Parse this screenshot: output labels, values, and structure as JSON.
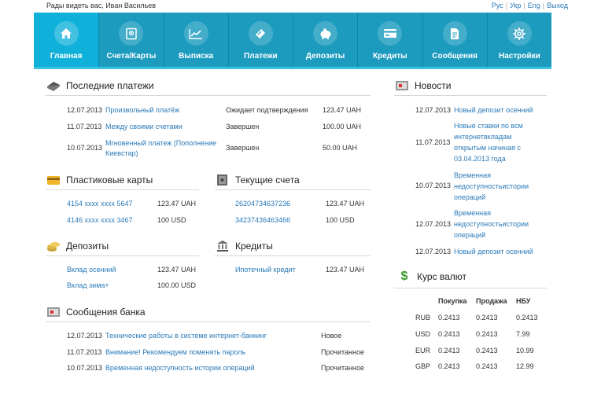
{
  "header": {
    "greeting": "Рады видеть вас, Иван Васильев",
    "langs": [
      "Рус",
      "Укр",
      "Eng"
    ],
    "logout": "Выход"
  },
  "nav": [
    {
      "label": "Главная",
      "icon": "home-icon"
    },
    {
      "label": "Счета/Карты",
      "icon": "accounts-icon"
    },
    {
      "label": "Выписка",
      "icon": "statement-chart-icon"
    },
    {
      "label": "Платежи",
      "icon": "wallet-icon"
    },
    {
      "label": "Депозиты",
      "icon": "piggy-bank-icon"
    },
    {
      "label": "Кредиты",
      "icon": "credit-card-icon"
    },
    {
      "label": "Сообщения",
      "icon": "document-icon"
    },
    {
      "label": "Настройки",
      "icon": "gear-icon"
    }
  ],
  "colors": {
    "nav": "#1c9bbf",
    "nav_active": "#0fb0d9",
    "link": "#2a7ab8"
  },
  "payments": {
    "title": "Последние платежи",
    "rows": [
      {
        "date": "12.07.2013",
        "name": "Произвольный платёж",
        "status": "Ожидает подтверждения",
        "amount": "123.47 UAH"
      },
      {
        "date": "11.07.2013",
        "name": "Между своими счетами",
        "status": "Завершен",
        "amount": "100.00 UAH"
      },
      {
        "date": "10.07.2013",
        "name": "Мгновенный платеж (Пополнение Киевстар)",
        "status": "Завершен",
        "amount": "50.00 UAH"
      }
    ]
  },
  "cards": {
    "title": "Пластиковые карты",
    "rows": [
      {
        "number": "4154 xxxx xxxx 5647",
        "amount": "123.47 UAH"
      },
      {
        "number": "4146 xxxx xxxx 3467",
        "amount": "100 USD"
      }
    ]
  },
  "accounts": {
    "title": "Текущие счета",
    "rows": [
      {
        "number": "26204734637236",
        "amount": "123.47 UAH"
      },
      {
        "number": "34237436463466",
        "amount": "100 USD"
      }
    ]
  },
  "deposits": {
    "title": "Депозиты",
    "rows": [
      {
        "name": "Вклад осенний",
        "amount": "123.47 UAH"
      },
      {
        "name": "Вклад зима+",
        "amount": "100.00 USD"
      }
    ]
  },
  "credits": {
    "title": "Кредиты",
    "rows": [
      {
        "name": "Ипотечный кредит",
        "amount": "123.47 UAH"
      }
    ]
  },
  "messages": {
    "title": "Сообщения банка",
    "rows": [
      {
        "date": "12.07.2013",
        "text": "Технические работы в системе интернет-банкинг",
        "status": "Новое"
      },
      {
        "date": "11.07.2013",
        "text": "Внимание! Рекомендуем поменять пароль",
        "status": "Прочитанное"
      },
      {
        "date": "10.07.2013",
        "text": "Временная недоступность истории операций",
        "status": "Прочитанное"
      }
    ]
  },
  "news": {
    "title": "Новости",
    "rows": [
      {
        "date": "12.07.2013",
        "lines": [
          "Новый депозит осенний"
        ]
      },
      {
        "date": "11.07.2013",
        "lines": [
          "Новые ставки по всм",
          "интернетвкладам",
          "открытым начиная с",
          "03.04.2013 года"
        ]
      },
      {
        "date": "10.07.2013",
        "lines": [
          "Временная",
          "недоступностьистории",
          "операций"
        ]
      },
      {
        "date": "12.07.2013",
        "lines": [
          "Временная",
          "недоступностьистории",
          "операций"
        ]
      },
      {
        "date": "12.07.2013",
        "lines": [
          "Новый депозит осенний"
        ]
      }
    ]
  },
  "rates": {
    "title": "Курс валют",
    "headers": [
      "Покупка",
      "Продажа",
      "НБУ"
    ],
    "rows": [
      {
        "cur": "RUB",
        "buy": "0.2413",
        "sell": "0.2413",
        "nbu": "0.2413"
      },
      {
        "cur": "USD",
        "buy": "0.2413",
        "sell": "0.2413",
        "nbu": "7.99"
      },
      {
        "cur": "EUR",
        "buy": "0.2413",
        "sell": "0.2413",
        "nbu": "10.99"
      },
      {
        "cur": "GBP",
        "buy": "0.2413",
        "sell": "0.2413",
        "nbu": "12.99"
      }
    ]
  }
}
